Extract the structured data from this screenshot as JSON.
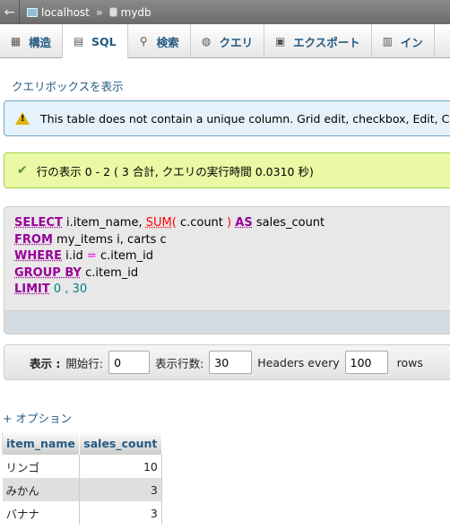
{
  "breadcrumb": {
    "back_glyph": "←",
    "server": "localhost",
    "separator": "»",
    "database": "mydb"
  },
  "tabs": [
    {
      "label": "構造",
      "icon": "structure-icon"
    },
    {
      "label": "SQL",
      "icon": "sql-icon"
    },
    {
      "label": "検索",
      "icon": "search-icon"
    },
    {
      "label": "クエリ",
      "icon": "query-icon"
    },
    {
      "label": "エクスポート",
      "icon": "export-icon"
    },
    {
      "label": "イン",
      "icon": "import-icon"
    }
  ],
  "show_query_link": "クエリボックスを表示",
  "notice": {
    "text": "This table does not contain a unique column. Grid edit, checkbox, Edit, C"
  },
  "success": {
    "text": "行の表示 0 - 2 ( 3 合計, クエリの実行時間 0.0310 秒)"
  },
  "sql": {
    "select_kw": "SELECT",
    "col1": "i.item_name,",
    "fn": "SUM",
    "paren_open": "(",
    "fn_arg": "c.count",
    "paren_close": ")",
    "as_kw": "AS",
    "alias": "sales_count",
    "from_kw": "FROM",
    "from_rest": "my_items i, carts c",
    "where_kw": "WHERE",
    "where_left": "i.id",
    "where_op": "=",
    "where_right": "c.item_id",
    "group_kw": "GROUP BY",
    "group_rest": "c.item_id",
    "limit_kw": "LIMIT",
    "limit_a": "0",
    "limit_comma": ",",
    "limit_b": "30"
  },
  "nav": {
    "label": "表示 :",
    "start_label": "開始行:",
    "start_value": "0",
    "rows_label": "表示行数:",
    "rows_value": "30",
    "headers_label": "Headers every",
    "headers_value": "100",
    "rows_suffix": "rows"
  },
  "options_link": "+ オプション",
  "table": {
    "headers": [
      "item_name",
      "sales_count"
    ],
    "rows": [
      [
        "リンゴ",
        "10"
      ],
      [
        "みかん",
        "3"
      ],
      [
        "バナナ",
        "3"
      ]
    ]
  }
}
